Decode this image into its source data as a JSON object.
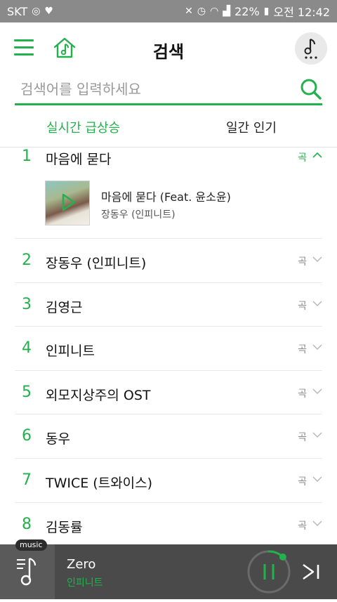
{
  "status_bar": {
    "carrier": "SKT",
    "battery": "22%",
    "time": "오전 12:42"
  },
  "header": {
    "title": "검색"
  },
  "search": {
    "placeholder": "검색어를 입력하세요",
    "value": ""
  },
  "tabs": [
    {
      "label": "실시간 급상승",
      "active": true
    },
    {
      "label": "일간 인기",
      "active": false
    }
  ],
  "rankings": [
    {
      "rank": "1",
      "keyword": "마음에 묻다",
      "type": "곡",
      "expanded": true,
      "song": {
        "title": "마음에 묻다 (Feat. 윤소윤)",
        "artist": "장동우 (인피니트)"
      }
    },
    {
      "rank": "2",
      "keyword": "장동우 (인피니트)",
      "type": "곡"
    },
    {
      "rank": "3",
      "keyword": "김영근",
      "type": "곡"
    },
    {
      "rank": "4",
      "keyword": "인피니트",
      "type": "곡"
    },
    {
      "rank": "5",
      "keyword": "외모지상주의 OST",
      "type": "곡"
    },
    {
      "rank": "6",
      "keyword": "동우",
      "type": "곡"
    },
    {
      "rank": "7",
      "keyword": "TWICE (트와이스)",
      "type": "곡"
    },
    {
      "rank": "8",
      "keyword": "김동률",
      "type": "곡"
    }
  ],
  "player": {
    "badge": "music",
    "title": "Zero",
    "artist": "인피니트",
    "progress": 0.12
  },
  "colors": {
    "accent": "#22b14c",
    "player_bg": "#4a4a4a",
    "status_bg": "#8a8a8a"
  }
}
